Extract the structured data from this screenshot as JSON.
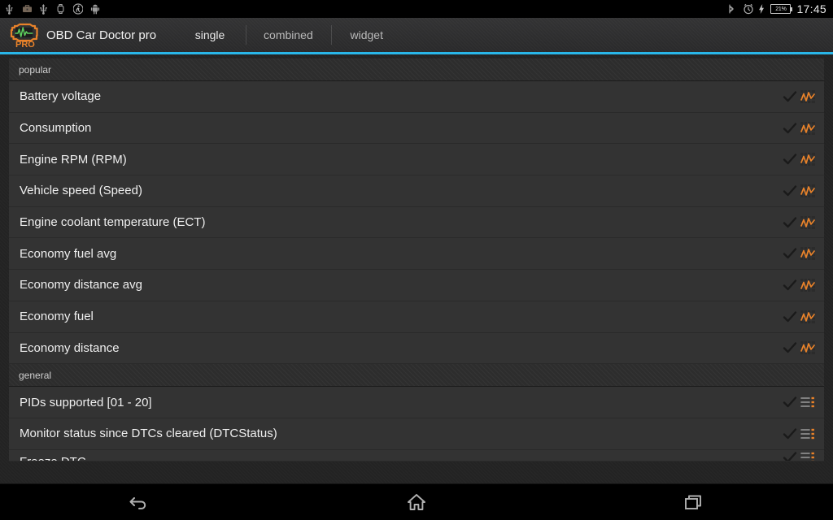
{
  "statusbar": {
    "left_icons": [
      "usb-icon",
      "briefcase-icon",
      "usb-debug-icon",
      "watch-icon",
      "runner-icon",
      "android-icon"
    ],
    "right_icons": [
      "bluetooth-icon",
      "alarm-icon",
      "charging-bolt-icon"
    ],
    "battery_percent": "21%",
    "time": "17:45"
  },
  "actionbar": {
    "logo_name": "obd-car-doctor-logo",
    "logo_badge": "PRO",
    "title": "OBD Car Doctor pro",
    "accent_color": "#29b6e8",
    "tabs": [
      {
        "label": "single",
        "active": true
      },
      {
        "label": "combined",
        "active": false
      },
      {
        "label": "widget",
        "active": false
      }
    ]
  },
  "list": {
    "sections": [
      {
        "header": "popular",
        "rows": [
          {
            "label": "Battery voltage",
            "icons": [
              "check-icon",
              "graph-icon"
            ]
          },
          {
            "label": "Consumption",
            "icons": [
              "check-icon",
              "graph-icon"
            ]
          },
          {
            "label": "Engine RPM (RPM)",
            "icons": [
              "check-icon",
              "graph-icon"
            ]
          },
          {
            "label": "Vehicle speed (Speed)",
            "icons": [
              "check-icon",
              "graph-icon"
            ]
          },
          {
            "label": "Engine coolant temperature (ECT)",
            "icons": [
              "check-icon",
              "graph-icon"
            ]
          },
          {
            "label": "Economy fuel avg",
            "icons": [
              "check-icon",
              "graph-icon"
            ]
          },
          {
            "label": "Economy distance avg",
            "icons": [
              "check-icon",
              "graph-icon"
            ]
          },
          {
            "label": "Economy fuel",
            "icons": [
              "check-icon",
              "graph-icon"
            ]
          },
          {
            "label": "Economy distance",
            "icons": [
              "check-icon",
              "graph-icon"
            ]
          }
        ]
      },
      {
        "header": "general",
        "rows": [
          {
            "label": "PIDs supported [01 - 20]",
            "icons": [
              "check-icon",
              "list-icon"
            ]
          },
          {
            "label": "Monitor status since DTCs cleared (DTCStatus)",
            "icons": [
              "check-icon",
              "list-icon"
            ]
          },
          {
            "label": "Freeze DTC",
            "icons": [
              "check-icon",
              "list-icon"
            ],
            "partial": true
          }
        ]
      }
    ]
  },
  "navbar": {
    "buttons": [
      {
        "name": "back",
        "icon": "back-arrow-icon"
      },
      {
        "name": "home",
        "icon": "home-icon"
      },
      {
        "name": "recents",
        "icon": "recents-icon"
      }
    ]
  },
  "colors": {
    "accent": "#29b6e8",
    "row_bg": "#333333",
    "page_bg": "#232323",
    "icon_orange": "#e8822a",
    "text": "#efefef"
  }
}
